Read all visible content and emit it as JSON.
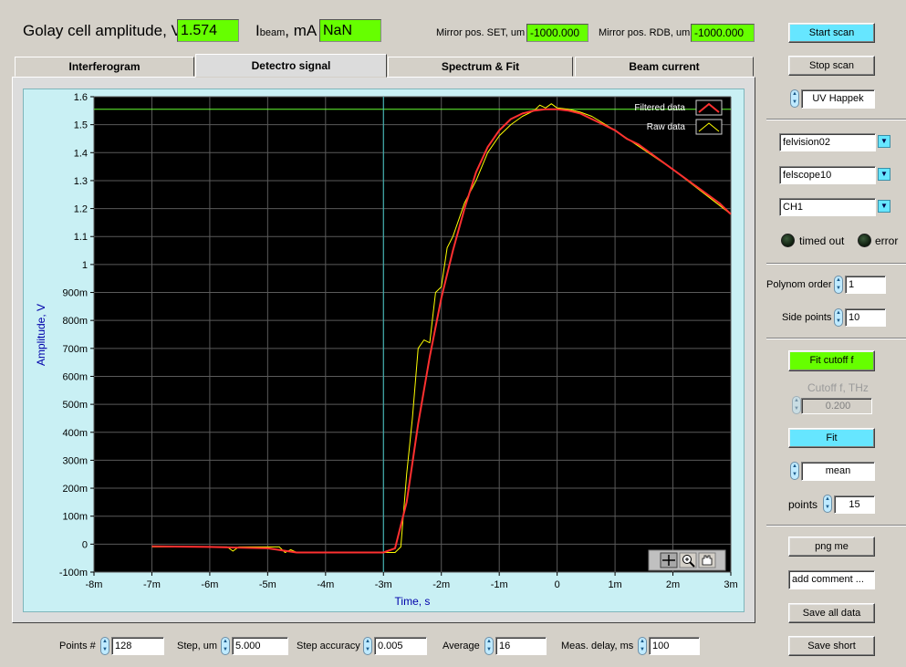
{
  "header": {
    "golay_label": "Golay cell amplitude, V",
    "golay_value": "1.574",
    "ibeam_label_i": "I",
    "ibeam_label_sub": "beam",
    "ibeam_label_unit": ", mA",
    "ibeam_value": "NaN",
    "mirror_set_label": "Mirror pos. SET, um",
    "mirror_set_value": "-1000.000",
    "mirror_rdb_label": "Mirror pos. RDB, um",
    "mirror_rdb_value": "-1000.000"
  },
  "tabs": [
    {
      "label": "Interferogram",
      "active": false
    },
    {
      "label": "Detectro signal",
      "active": true
    },
    {
      "label": "Spectrum & Fit",
      "active": false
    },
    {
      "label": "Beam current",
      "active": false
    }
  ],
  "right_panel": {
    "start_scan": "Start scan",
    "stop_scan": "Stop scan",
    "mode_select": "UV Happek",
    "server_select": "felvision02",
    "scope_select": "felscope10",
    "channel_select": "CH1",
    "led_timed_out": "timed out",
    "led_error": "error",
    "polynom_order_label": "Polynom order",
    "polynom_order_value": "1",
    "side_points_label": "Side points",
    "side_points_value": "10",
    "fit_cutoff_button": "Fit cutoff f",
    "cutoff_label": "Cutoff f, THz",
    "cutoff_value": "0.200",
    "fit_button": "Fit",
    "mean_select": "mean",
    "points_label": "points",
    "points_value": "15",
    "png_me": "png me",
    "add_comment": "add comment ...",
    "save_all": "Save all data",
    "save_short": "Save short"
  },
  "bottom": {
    "points_label": "Points #",
    "points_value": "128",
    "step_label": "Step, um",
    "step_value": "5.000",
    "accuracy_label": "Step accuracy",
    "accuracy_value": "0.005",
    "average_label": "Average",
    "average_value": "16",
    "delay_label": "Meas. delay, ms",
    "delay_value": "100"
  },
  "colors": {
    "plot_bg": "#000000",
    "grid": "#5a5a5a",
    "filtered": "#ff3030",
    "raw": "#ffff00",
    "cursor_h": "#66ff33",
    "cursor_v": "#3fbfbf",
    "axis_title": "#0000aa",
    "value_green": "#66ff00",
    "button_cyan": "#66e6ff"
  },
  "chart_data": {
    "type": "line",
    "xlabel": "Time, s",
    "ylabel": "Amplitude, V",
    "xlim": [
      -0.008,
      0.003
    ],
    "ylim": [
      -0.1,
      1.6
    ],
    "x_tick_labels": [
      "-8m",
      "-7m",
      "-6m",
      "-5m",
      "-4m",
      "-3m",
      "-2m",
      "-1m",
      "0",
      "1m",
      "2m",
      "3m"
    ],
    "y_tick_labels": [
      "-100m",
      "0",
      "100m",
      "200m",
      "300m",
      "400m",
      "500m",
      "600m",
      "700m",
      "800m",
      "900m",
      "1",
      "1.1",
      "1.2",
      "1.3",
      "1.4",
      "1.5",
      "1.6"
    ],
    "grid": true,
    "legend_position": "top-right",
    "cursors": {
      "horizontal_y": 1.555,
      "vertical_x": -0.003
    },
    "series": [
      {
        "name": "Filtered data",
        "x": [
          -0.007,
          -0.006,
          -0.005,
          -0.0045,
          -0.004,
          -0.0035,
          -0.003,
          -0.0028,
          -0.0026,
          -0.0024,
          -0.0022,
          -0.002,
          -0.0018,
          -0.0016,
          -0.0014,
          -0.0012,
          -0.001,
          -0.0008,
          -0.0006,
          -0.0004,
          -0.0002,
          0.0,
          0.0002,
          0.0004,
          0.0006,
          0.0008,
          0.001,
          0.0012,
          0.0014,
          0.0016,
          0.0018,
          0.002,
          0.0022,
          0.0024,
          0.0026,
          0.0028,
          0.003
        ],
        "y": [
          -0.008,
          -0.01,
          -0.015,
          -0.03,
          -0.03,
          -0.03,
          -0.03,
          -0.015,
          0.15,
          0.43,
          0.67,
          0.88,
          1.05,
          1.2,
          1.33,
          1.42,
          1.48,
          1.52,
          1.54,
          1.55,
          1.555,
          1.555,
          1.55,
          1.54,
          1.52,
          1.5,
          1.48,
          1.45,
          1.43,
          1.4,
          1.37,
          1.34,
          1.31,
          1.28,
          1.25,
          1.22,
          1.18
        ]
      },
      {
        "name": "Raw data",
        "x": [
          -0.007,
          -0.0057,
          -0.0056,
          -0.0055,
          -0.0048,
          -0.0047,
          -0.0046,
          -0.0045,
          -0.004,
          -0.003,
          -0.0028,
          -0.0027,
          -0.0026,
          -0.0025,
          -0.0024,
          -0.0023,
          -0.0022,
          -0.0021,
          -0.002,
          -0.0019,
          -0.0018,
          -0.0016,
          -0.0014,
          -0.0012,
          -0.001,
          -0.0008,
          -0.0006,
          -0.0004,
          -0.0003,
          -0.0002,
          -0.0001,
          0.0,
          0.0002,
          0.0004,
          0.0006,
          0.001,
          0.0015,
          0.002,
          0.0025,
          0.003
        ],
        "y": [
          -0.01,
          -0.01,
          -0.025,
          -0.01,
          -0.01,
          -0.03,
          -0.02,
          -0.03,
          -0.03,
          -0.03,
          -0.03,
          -0.01,
          0.25,
          0.45,
          0.7,
          0.73,
          0.72,
          0.9,
          0.92,
          1.06,
          1.1,
          1.22,
          1.3,
          1.4,
          1.46,
          1.5,
          1.53,
          1.55,
          1.57,
          1.56,
          1.575,
          1.56,
          1.555,
          1.545,
          1.53,
          1.48,
          1.41,
          1.34,
          1.26,
          1.18
        ]
      }
    ]
  }
}
